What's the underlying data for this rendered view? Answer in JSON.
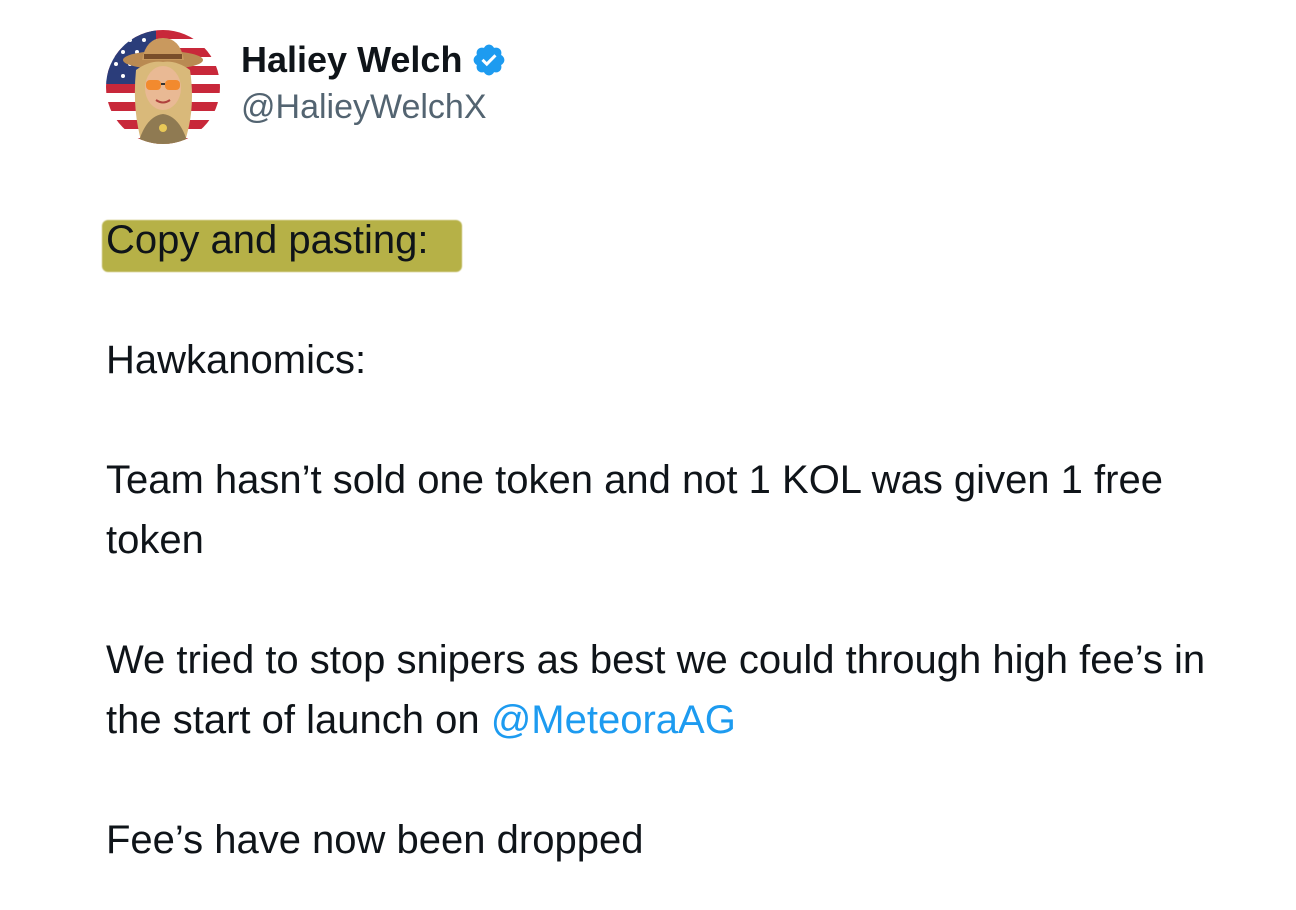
{
  "author": {
    "display_name": "Haliey Welch",
    "handle": "@HalieyWelchX",
    "verified_icon": "verified-badge-icon",
    "verified_color": "#1d9bf0"
  },
  "tweet": {
    "highlighted_line": "Copy and pasting:",
    "highlight_color": "#b3ad3e",
    "heading": "Hawkanomics:",
    "para1": "Team hasn’t sold one token and not 1 KOL was given 1 free token",
    "para2_text": "We tried to stop snipers as best we could through high fee’s in the start of launch on ",
    "para2_mention": "@MeteoraAG",
    "para3": "Fee’s have now been dropped"
  },
  "colors": {
    "text": "#0f1419",
    "secondary": "#536471",
    "link": "#1d9bf0"
  }
}
